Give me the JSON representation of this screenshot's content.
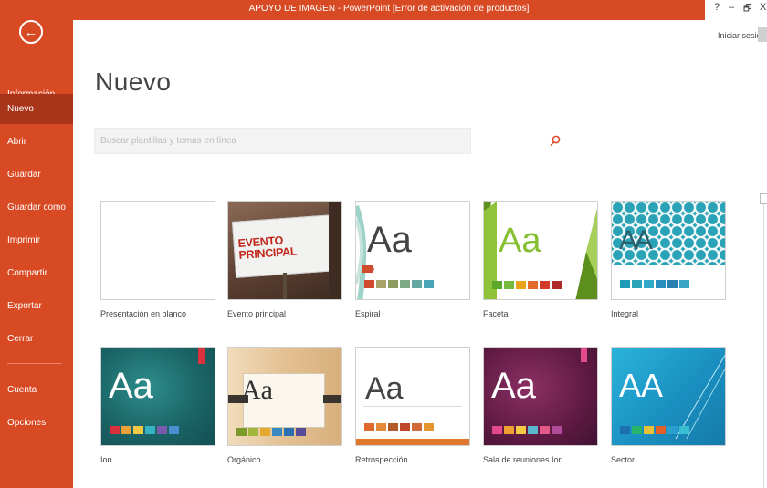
{
  "titlebar": {
    "text": "APOYO DE IMAGEN -  PowerPoint [Error de activación de productos]"
  },
  "window_controls": {
    "help": "?",
    "minimize": "–",
    "restore": "🗗",
    "close": "X"
  },
  "account": {
    "signin": "Iniciar sesión"
  },
  "sidebar": {
    "back": "←",
    "items": [
      {
        "label": "Información"
      },
      {
        "label": "Nuevo",
        "active": true
      },
      {
        "label": "Abrir"
      },
      {
        "label": "Guardar"
      },
      {
        "label": "Guardar como"
      },
      {
        "label": "Imprimir"
      },
      {
        "label": "Compartir"
      },
      {
        "label": "Exportar"
      },
      {
        "label": "Cerrar"
      },
      {
        "label": "Cuenta"
      },
      {
        "label": "Opciones"
      }
    ]
  },
  "main": {
    "title": "Nuevo",
    "search": {
      "placeholder": "Buscar plantillas y temas en línea",
      "icon": "search-icon"
    },
    "templates": [
      {
        "label": "Presentación en blanco"
      },
      {
        "label": "Evento principal",
        "banner": "EVENTO PRINCIPAL"
      },
      {
        "label": "Espiral",
        "sample": "Aa"
      },
      {
        "label": "Faceta",
        "sample": "Aa"
      },
      {
        "label": "Integral",
        "sample": "AA"
      },
      {
        "label": "Ion",
        "sample": "Aa"
      },
      {
        "label": "Orgánico",
        "sample": "Aa"
      },
      {
        "label": "Retrospección",
        "sample": "Aa"
      },
      {
        "label": "Sala de reuniones Ion",
        "sample": "Aa"
      },
      {
        "label": "Sector",
        "sample": "AA"
      }
    ]
  },
  "colors": {
    "accent": "#d84a24",
    "accent_dark": "#a8341a"
  }
}
